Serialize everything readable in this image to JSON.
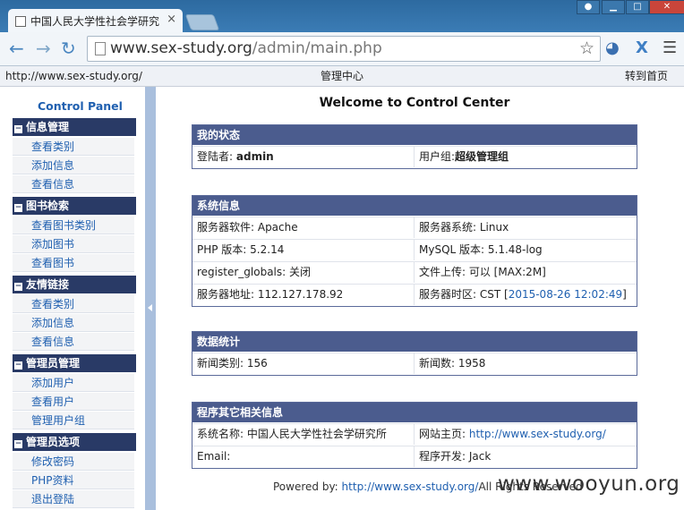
{
  "browser": {
    "tab_title": "中国人民大学性社会学研究",
    "url_host": "www.sex-study.org",
    "url_path": "/admin/main.php"
  },
  "topbar": {
    "site_url": "http://www.sex-study.org/",
    "center": "管理中心",
    "home_link": "转到首页"
  },
  "sidebar": {
    "title": "Control Panel",
    "sections": [
      {
        "label": "信息管理",
        "items": [
          "查看类别",
          "添加信息",
          "查看信息"
        ]
      },
      {
        "label": "图书检索",
        "items": [
          "查看图书类别",
          "添加图书",
          "查看图书"
        ]
      },
      {
        "label": "友情链接",
        "items": [
          "查看类别",
          "添加信息",
          "查看信息"
        ]
      },
      {
        "label": "管理员管理",
        "items": [
          "添加用户",
          "查看用户",
          "管理用户组"
        ]
      },
      {
        "label": "管理员选项",
        "items": [
          "修改密码",
          "PHP资料",
          "退出登陆"
        ]
      }
    ]
  },
  "main": {
    "welcome": "Welcome to Control Center",
    "status": {
      "title": "我的状态",
      "login_label": "登陆者:",
      "login_value": "admin",
      "group_label": "用户组:",
      "group_value": "超级管理组"
    },
    "sysinfo": {
      "title": "系统信息",
      "server_software": "服务器软件: Apache",
      "server_os": "服务器系统: Linux",
      "php_version": "PHP 版本: 5.2.14",
      "mysql_version": "MySQL 版本: 5.1.48-log",
      "register_globals": "register_globals: 关闭",
      "upload": "文件上传: 可以 [MAX:2M]",
      "server_addr": "服务器地址: 112.127.178.92",
      "tz_prefix": "服务器时区: CST [",
      "tz_time": "2015-08-26 12:02:49",
      "tz_suffix": "]"
    },
    "stats": {
      "title": "数据统计",
      "news_categories": "新闻类别: 156",
      "news_count": "新闻数: 1958"
    },
    "other": {
      "title": "程序其它相关信息",
      "system_name": "系统名称: 中国人民大学性社会学研究所",
      "site_label": "网站主页: ",
      "site_url": "http://www.sex-study.org/",
      "email": "Email:",
      "developer": "程序开发: Jack"
    },
    "footer": {
      "prefix": "Powered by: ",
      "link": "http://www.sex-study.org/",
      "suffix": "All Rights Reserved"
    }
  },
  "watermark": "www.wooyun.org"
}
